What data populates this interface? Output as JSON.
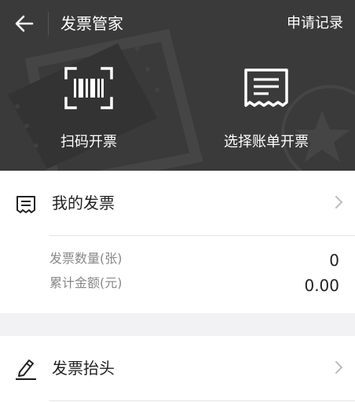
{
  "topbar": {
    "title": "发票管家",
    "history_label": "申请记录"
  },
  "actions": [
    {
      "label": "扫码开票",
      "icon": "barcode-scan-icon"
    },
    {
      "label": "选择账单开票",
      "icon": "receipt-bill-icon"
    }
  ],
  "my_invoices": {
    "label": "我的发票",
    "icon": "invoice-list-icon",
    "count_label": "发票数量(张)",
    "count_value": "0",
    "total_label": "累计金额(元)",
    "total_value": "0.00"
  },
  "invoice_header": {
    "label": "发票抬头",
    "icon": "pencil-edit-icon"
  },
  "colors": {
    "header_bg": "#3a3a3a",
    "page_bg": "#f2f2f4",
    "card_bg": "#ffffff",
    "text_primary": "#222222",
    "text_secondary": "#888888"
  }
}
